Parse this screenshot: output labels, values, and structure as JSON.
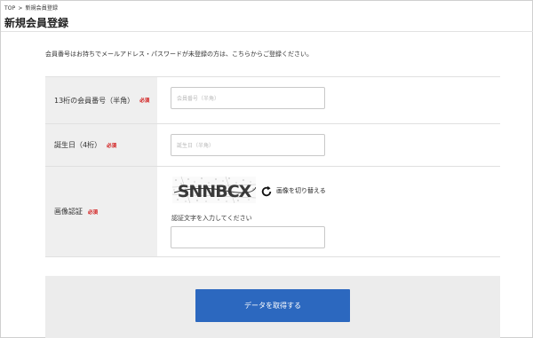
{
  "breadcrumb": {
    "home": "TOP",
    "separator": ">",
    "current": "新規会員登録"
  },
  "page": {
    "title": "新規会員登録",
    "intro": "会員番号はお持ちでメールアドレス・パスワードが未登録の方は、こちらからご登録ください。"
  },
  "form": {
    "required_label": "必須",
    "member_number": {
      "label": "13桁の会員番号（半角）",
      "placeholder": "会員番号（半角）"
    },
    "birthday": {
      "label": "誕生日（4桁）",
      "placeholder": "誕生日（半角）"
    },
    "captcha": {
      "label": "画像認証",
      "image_text": "SNNBCX",
      "refresh_label": "画像を切り替える",
      "hint": "認証文字を入力してください",
      "placeholder": ""
    }
  },
  "submit": {
    "label": "データを取得する"
  },
  "colors": {
    "primary": "#2c68bf",
    "required": "#d01010",
    "label_bg": "#efefef"
  }
}
